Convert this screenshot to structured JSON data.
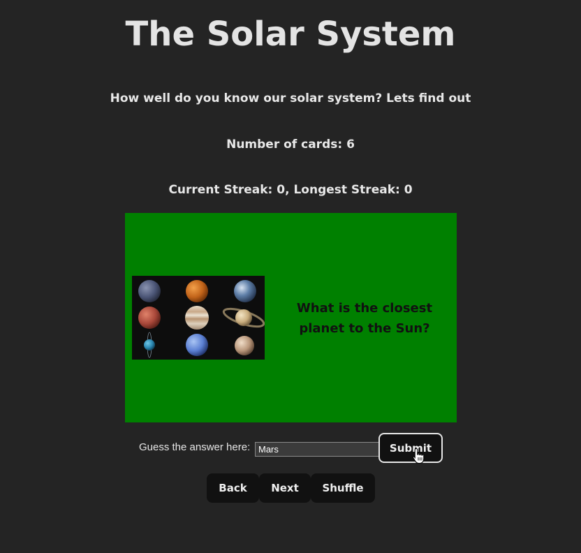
{
  "header": {
    "title": "The Solar System",
    "intro": "How well do you know our solar system? Lets find out",
    "card_count": "Number of cards: 6",
    "streaks": "Current Streak: 0, Longest Streak: 0"
  },
  "card": {
    "question": "What is the closest planet to the Sun?",
    "background_color": "#008000",
    "image": "solar-system-planets-grid"
  },
  "guess": {
    "label": "Guess the answer here:",
    "value": "Mars",
    "submit_label": "Submit"
  },
  "controls": {
    "back_label": "Back",
    "next_label": "Next",
    "shuffle_label": "Shuffle"
  }
}
